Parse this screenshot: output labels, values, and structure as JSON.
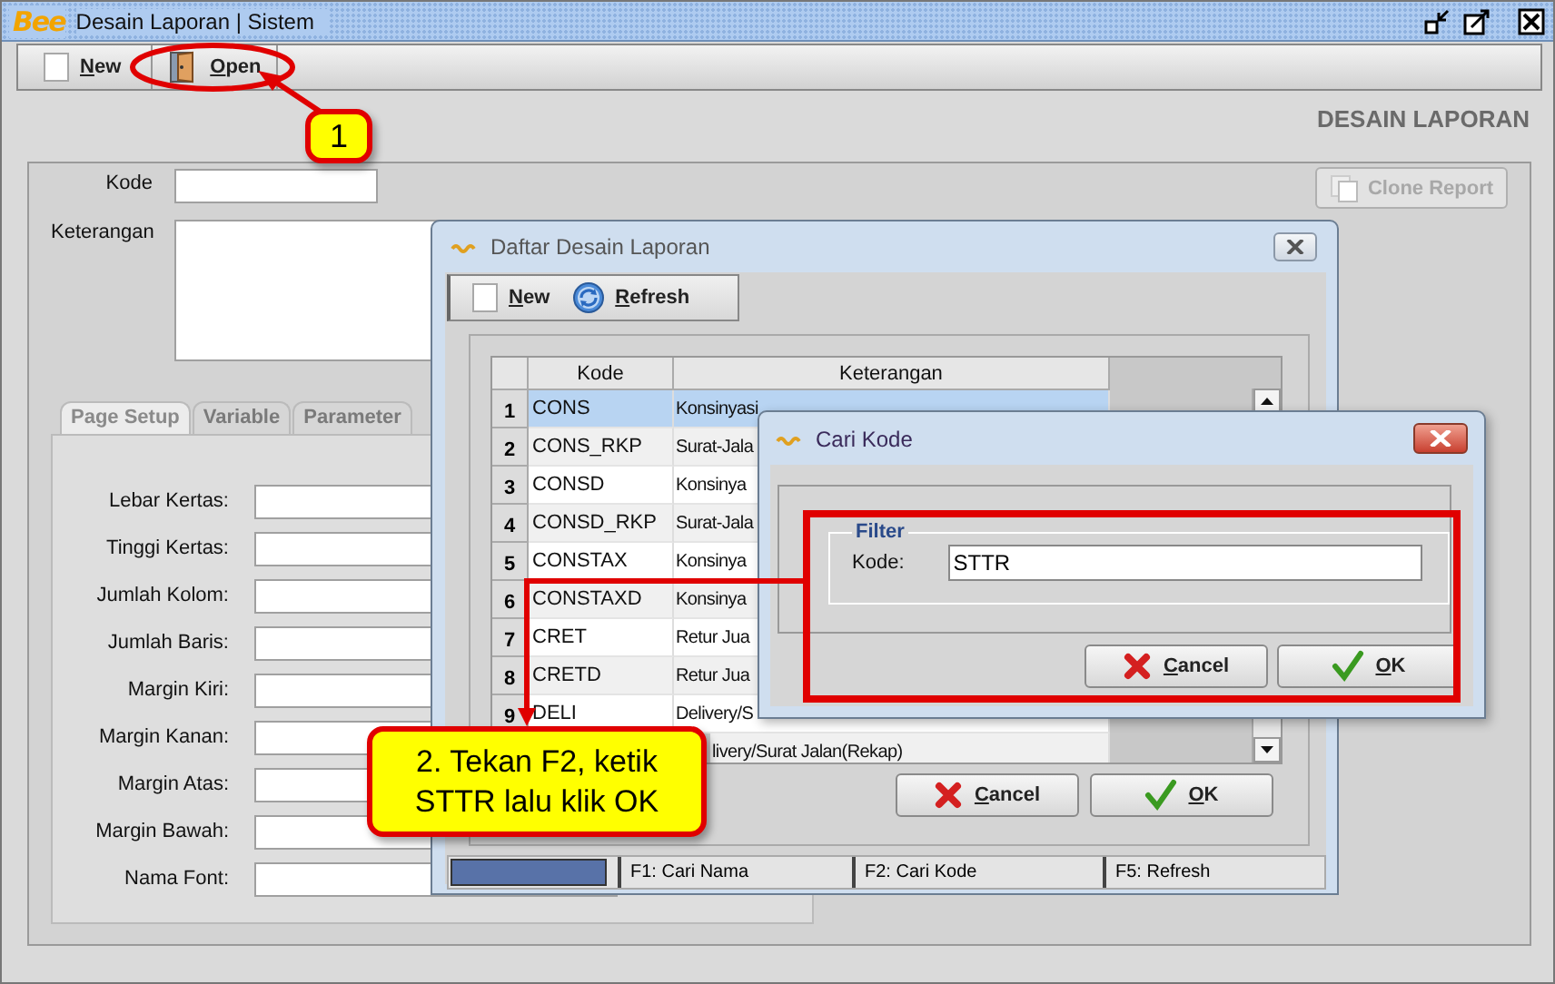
{
  "window": {
    "logo": "Bee",
    "title": "Desain Laporan | Sistem"
  },
  "toolbar": [
    {
      "label": "New",
      "kind": "new"
    },
    {
      "label": "Open",
      "kind": "open"
    }
  ],
  "header": "DESAIN LAPORAN",
  "form": {
    "kode_label": "Kode",
    "keterangan_label": "Keterangan",
    "clone_button": {
      "label": "Clone Report",
      "disabled": true
    }
  },
  "tabs": [
    {
      "label": "Page Setup",
      "selected": true
    },
    {
      "label": "Variable",
      "selected": false
    },
    {
      "label": "Parameter",
      "selected": false
    }
  ],
  "page_setup": [
    "Lebar Kertas:",
    "Tinggi Kertas:",
    "Jumlah Kolom:",
    "Jumlah Baris:",
    "Margin Kiri:",
    "Margin Kanan:",
    "Margin Atas:",
    "Margin Bawah:",
    "Nama Font:"
  ],
  "list_dialog": {
    "title": "Daftar Desain Laporan",
    "toolbar": [
      {
        "label": "New",
        "kind": "new"
      },
      {
        "label": "Refresh",
        "kind": "refresh"
      }
    ],
    "columns": [
      "Kode",
      "Keterangan"
    ],
    "rows": [
      {
        "number": "1",
        "kode": "CONS",
        "keterangan": "Konsinyasi",
        "selected": true
      },
      {
        "number": "2",
        "kode": "CONS_RKP",
        "keterangan": "Surat-Jala",
        "selected": false
      },
      {
        "number": "3",
        "kode": "CONSD",
        "keterangan": "Konsinya",
        "selected": false
      },
      {
        "number": "4",
        "kode": "CONSD_RKP",
        "keterangan": "Surat-Jala",
        "selected": false
      },
      {
        "number": "5",
        "kode": "CONSTAX",
        "keterangan": "Konsinya",
        "selected": false
      },
      {
        "number": "6",
        "kode": "CONSTAXD",
        "keterangan": "Konsinya",
        "selected": false
      },
      {
        "number": "7",
        "kode": "CRET",
        "keterangan": "Retur Jua",
        "selected": false
      },
      {
        "number": "8",
        "kode": "CRETD",
        "keterangan": "Retur Jua",
        "selected": false
      },
      {
        "number": "9",
        "kode": "DELI",
        "keterangan": "Delivery/S",
        "selected": false
      },
      {
        "keterangan": "livery/Surat Jalan(Rekap)",
        "selected": false
      }
    ],
    "buttons": [
      {
        "label": "Cancel",
        "kind": "cancel"
      },
      {
        "label": "OK",
        "kind": "ok"
      }
    ],
    "status_bar": [
      "F1: Cari Nama",
      "F2: Cari Kode",
      "F5: Refresh"
    ]
  },
  "find_dialog": {
    "title": "Cari Kode",
    "group": "Filter",
    "field_label": "Kode:",
    "value": "STTR",
    "buttons": [
      {
        "label": "Cancel",
        "kind": "cancel"
      },
      {
        "label": "OK",
        "kind": "ok"
      }
    ]
  },
  "callouts": [
    {
      "text": "1"
    },
    {
      "text": "2. Tekan F2, ketik STTR lalu klik OK"
    }
  ]
}
